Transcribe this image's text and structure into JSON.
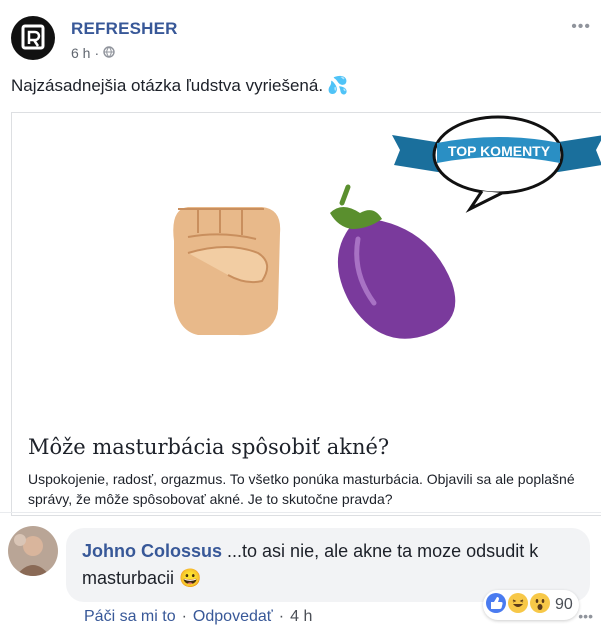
{
  "post": {
    "page_name": "REFRESHER",
    "time": "6 h",
    "separator": "·",
    "text": "Najzásadnejšia otázka ľudstva vyriešená.",
    "emoji": "💦"
  },
  "link_card": {
    "badge": "TOP KOMENTY",
    "title": "Môže masturbácia spôsobiť akné?",
    "description": "Uspokojenie, radosť, orgazmus. To všetko ponúka masturbácia. Objavili sa ale poplašné správy, že môže spôsobovať akné. Je to skutočne pravda?"
  },
  "comment": {
    "author": "Johno Colossus",
    "text": "...to asi nie, ale akne ta moze odsudit k masturbacii",
    "emoji": "😀",
    "actions": {
      "like": "Páči sa mi to",
      "sep": "·",
      "reply": "Odpovedať",
      "time": "4 h"
    },
    "reactions_count": "90"
  },
  "icons": [
    "refresher-logo-icon",
    "globe-icon",
    "more-icon",
    "fist-icon",
    "eggplant-icon",
    "like-reaction-icon",
    "haha-reaction-icon",
    "wow-reaction-icon"
  ],
  "colors": {
    "link": "#385898",
    "bubble": "#f2f3f5",
    "badge": "#2a8fc4"
  }
}
